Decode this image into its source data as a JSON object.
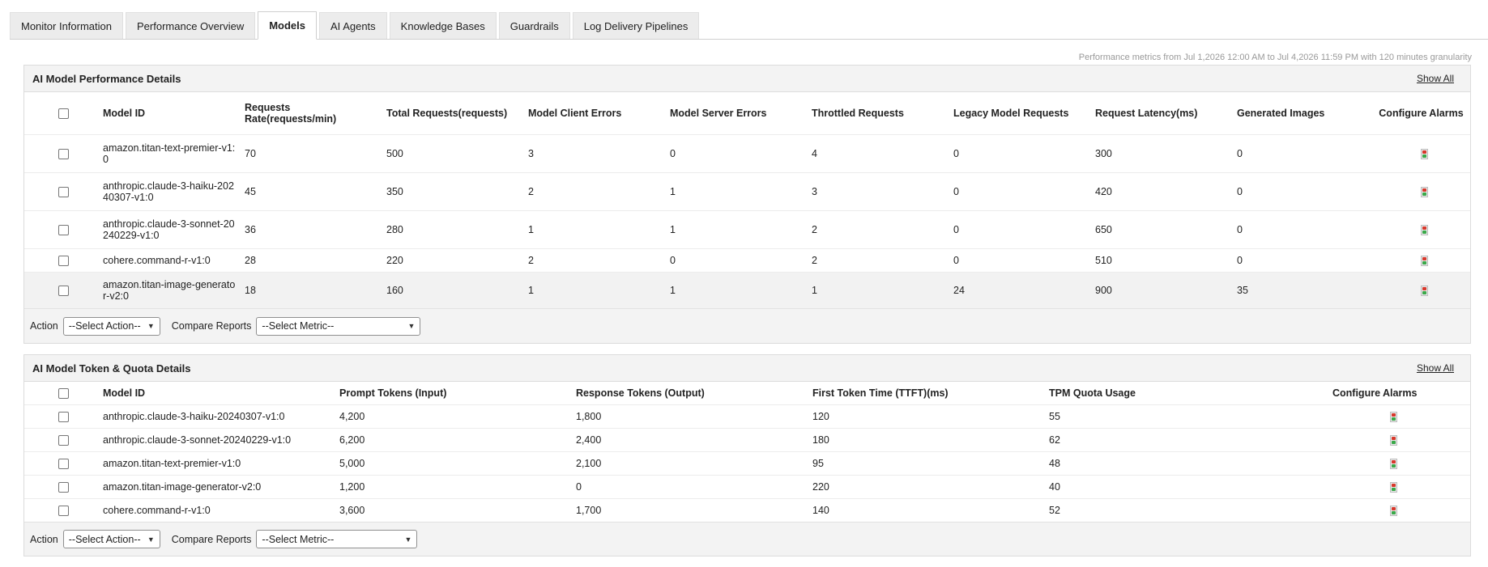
{
  "tabs": [
    "Monitor Information",
    "Performance Overview",
    "Models",
    "AI Agents",
    "Knowledge Bases",
    "Guardrails",
    "Log Delivery Pipelines"
  ],
  "active_tab": "Models",
  "granularity_text": "Performance metrics from Jul 1,2026 12:00 AM to Jul 4,2026 11:59 PM with 120 minutes granularity",
  "perf": {
    "title": "AI Model Performance Details",
    "show_all": "Show All",
    "headers": [
      "Model ID",
      "Requests Rate(requests/min)",
      "Total Requests(requests)",
      "Model Client Errors",
      "Model Server Errors",
      "Throttled Requests",
      "Legacy Model Requests",
      "Request Latency(ms)",
      "Generated Images",
      "Configure Alarms"
    ],
    "rows": [
      [
        "amazon.titan-text-premier-v1:0",
        "70",
        "500",
        "3",
        "0",
        "4",
        "0",
        "300",
        "0"
      ],
      [
        "anthropic.claude-3-haiku-20240307-v1:0",
        "45",
        "350",
        "2",
        "1",
        "3",
        "0",
        "420",
        "0"
      ],
      [
        "anthropic.claude-3-sonnet-20240229-v1:0",
        "36",
        "280",
        "1",
        "1",
        "2",
        "0",
        "650",
        "0"
      ],
      [
        "cohere.command-r-v1:0",
        "28",
        "220",
        "2",
        "0",
        "2",
        "0",
        "510",
        "0"
      ],
      [
        "amazon.titan-image-generator-v2:0",
        "18",
        "160",
        "1",
        "1",
        "1",
        "24",
        "900",
        "35"
      ]
    ],
    "action_label": "Action",
    "action_select": "--Select Action--",
    "compare_label": "Compare Reports",
    "compare_select": "--Select Metric--"
  },
  "tokens": {
    "title": "AI Model Token & Quota Details",
    "show_all": "Show All",
    "headers": [
      "Model ID",
      "Prompt Tokens (Input)",
      "Response Tokens (Output)",
      "First Token Time (TTFT)(ms)",
      "TPM Quota Usage",
      "Configure Alarms"
    ],
    "rows": [
      [
        "anthropic.claude-3-haiku-20240307-v1:0",
        "4,200",
        "1,800",
        "120",
        "55"
      ],
      [
        "anthropic.claude-3-sonnet-20240229-v1:0",
        "6,200",
        "2,400",
        "180",
        "62"
      ],
      [
        "amazon.titan-text-premier-v1:0",
        "5,000",
        "2,100",
        "95",
        "48"
      ],
      [
        "amazon.titan-image-generator-v2:0",
        "1,200",
        "0",
        "220",
        "40"
      ],
      [
        "cohere.command-r-v1:0",
        "3,600",
        "1,700",
        "140",
        "52"
      ]
    ],
    "action_label": "Action",
    "action_select": "--Select Action--",
    "compare_label": "Compare Reports",
    "compare_select": "--Select Metric--"
  }
}
